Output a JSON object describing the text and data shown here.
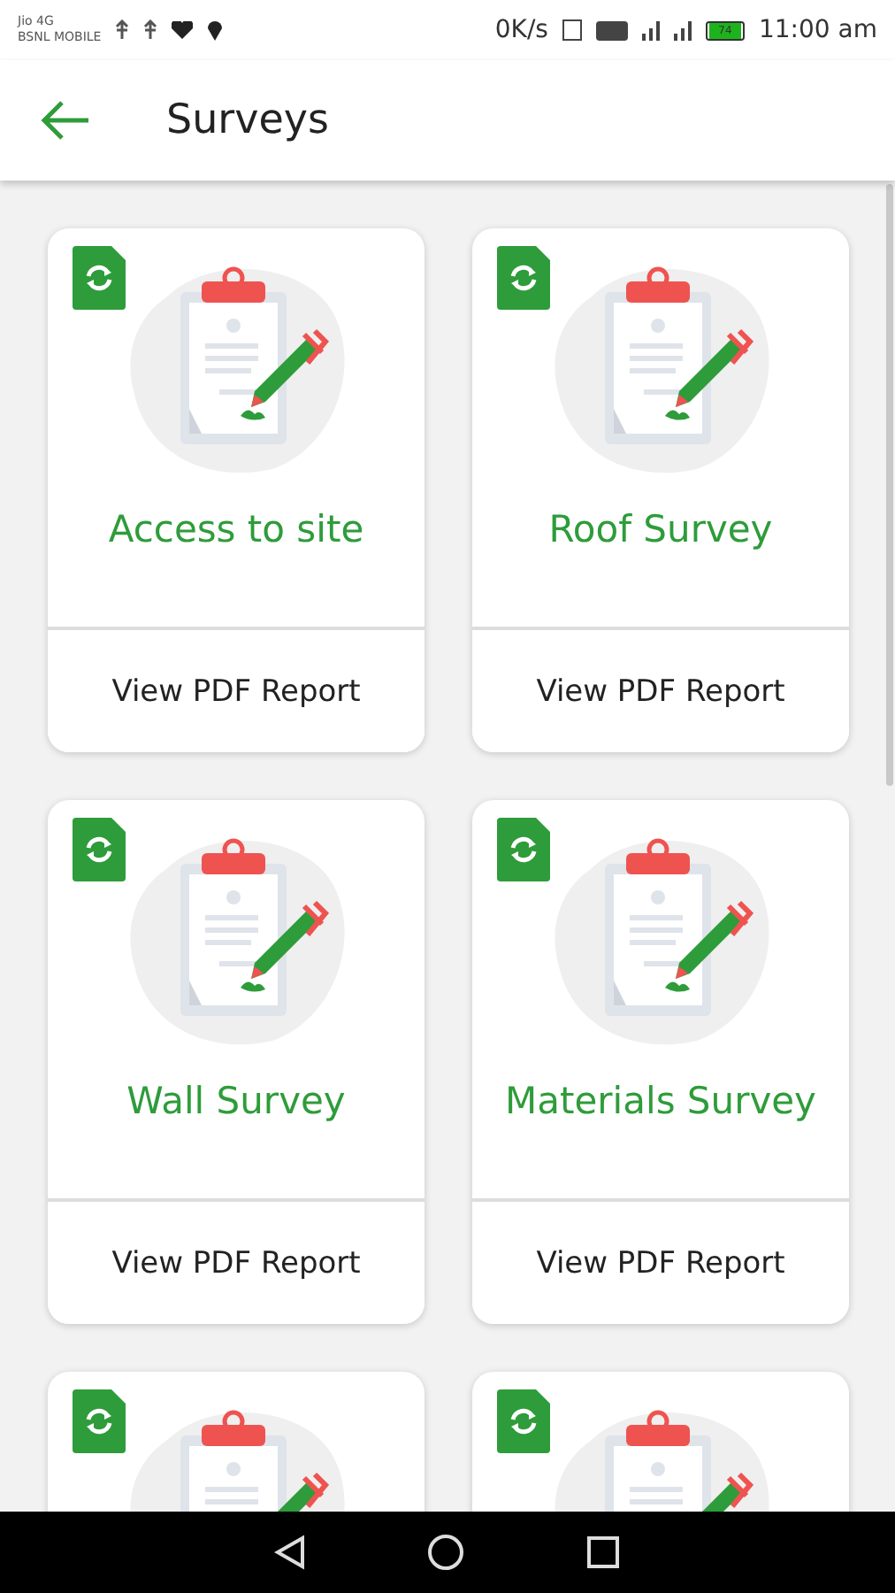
{
  "status_bar": {
    "carrier_1": "Jio 4G",
    "carrier_2": "BSNL MOBILE",
    "speed": "0K/s",
    "battery": "74",
    "time": "11:00 am"
  },
  "app_bar": {
    "title": "Surveys"
  },
  "cards": [
    {
      "kind": "full",
      "title": "Access to site",
      "action": "View PDF Report"
    },
    {
      "kind": "full",
      "title": "Roof Survey",
      "action": "View PDF Report"
    },
    {
      "kind": "full",
      "title": "Wall Survey",
      "action": "View PDF Report"
    },
    {
      "kind": "full",
      "title": "Materials Survey",
      "action": "View PDF Report"
    },
    {
      "kind": "partial"
    },
    {
      "kind": "partial"
    }
  ]
}
